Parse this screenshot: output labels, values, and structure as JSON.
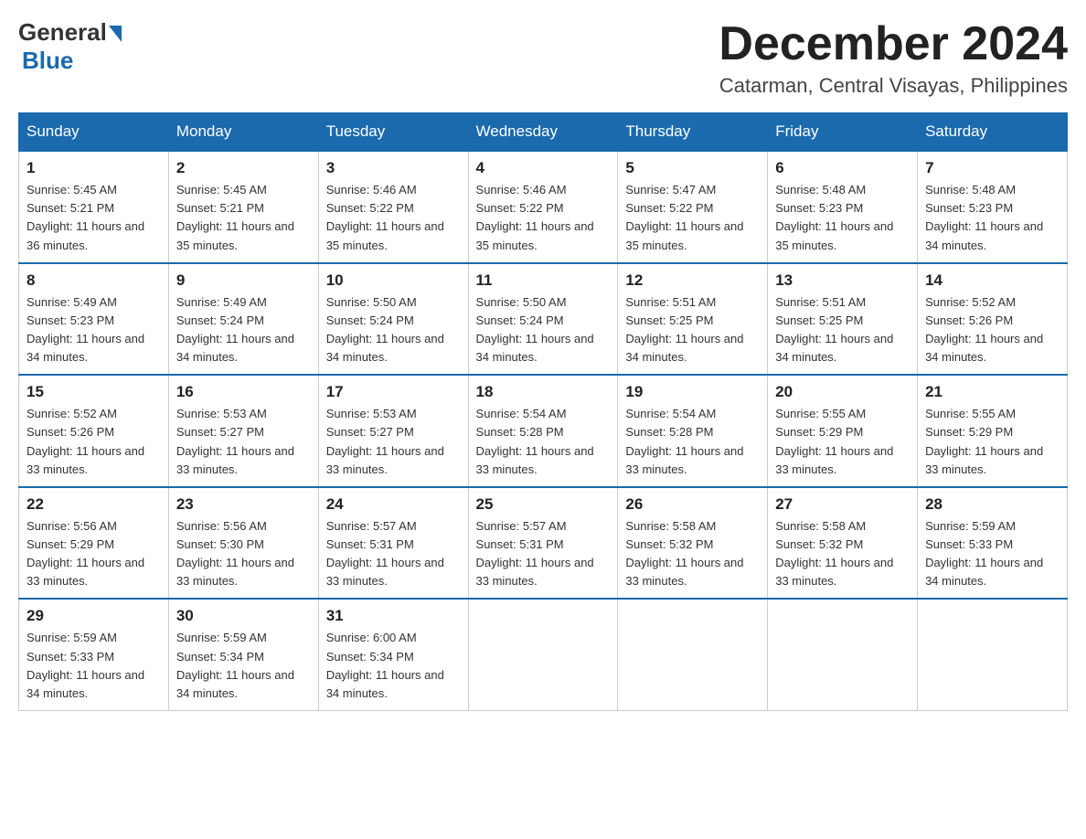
{
  "logo": {
    "general": "General",
    "blue": "Blue"
  },
  "header": {
    "month_year": "December 2024",
    "location": "Catarman, Central Visayas, Philippines"
  },
  "days_of_week": [
    "Sunday",
    "Monday",
    "Tuesday",
    "Wednesday",
    "Thursday",
    "Friday",
    "Saturday"
  ],
  "weeks": [
    [
      {
        "day": "1",
        "sunrise": "5:45 AM",
        "sunset": "5:21 PM",
        "daylight": "11 hours and 36 minutes."
      },
      {
        "day": "2",
        "sunrise": "5:45 AM",
        "sunset": "5:21 PM",
        "daylight": "11 hours and 35 minutes."
      },
      {
        "day": "3",
        "sunrise": "5:46 AM",
        "sunset": "5:22 PM",
        "daylight": "11 hours and 35 minutes."
      },
      {
        "day": "4",
        "sunrise": "5:46 AM",
        "sunset": "5:22 PM",
        "daylight": "11 hours and 35 minutes."
      },
      {
        "day": "5",
        "sunrise": "5:47 AM",
        "sunset": "5:22 PM",
        "daylight": "11 hours and 35 minutes."
      },
      {
        "day": "6",
        "sunrise": "5:48 AM",
        "sunset": "5:23 PM",
        "daylight": "11 hours and 35 minutes."
      },
      {
        "day": "7",
        "sunrise": "5:48 AM",
        "sunset": "5:23 PM",
        "daylight": "11 hours and 34 minutes."
      }
    ],
    [
      {
        "day": "8",
        "sunrise": "5:49 AM",
        "sunset": "5:23 PM",
        "daylight": "11 hours and 34 minutes."
      },
      {
        "day": "9",
        "sunrise": "5:49 AM",
        "sunset": "5:24 PM",
        "daylight": "11 hours and 34 minutes."
      },
      {
        "day": "10",
        "sunrise": "5:50 AM",
        "sunset": "5:24 PM",
        "daylight": "11 hours and 34 minutes."
      },
      {
        "day": "11",
        "sunrise": "5:50 AM",
        "sunset": "5:24 PM",
        "daylight": "11 hours and 34 minutes."
      },
      {
        "day": "12",
        "sunrise": "5:51 AM",
        "sunset": "5:25 PM",
        "daylight": "11 hours and 34 minutes."
      },
      {
        "day": "13",
        "sunrise": "5:51 AM",
        "sunset": "5:25 PM",
        "daylight": "11 hours and 34 minutes."
      },
      {
        "day": "14",
        "sunrise": "5:52 AM",
        "sunset": "5:26 PM",
        "daylight": "11 hours and 34 minutes."
      }
    ],
    [
      {
        "day": "15",
        "sunrise": "5:52 AM",
        "sunset": "5:26 PM",
        "daylight": "11 hours and 33 minutes."
      },
      {
        "day": "16",
        "sunrise": "5:53 AM",
        "sunset": "5:27 PM",
        "daylight": "11 hours and 33 minutes."
      },
      {
        "day": "17",
        "sunrise": "5:53 AM",
        "sunset": "5:27 PM",
        "daylight": "11 hours and 33 minutes."
      },
      {
        "day": "18",
        "sunrise": "5:54 AM",
        "sunset": "5:28 PM",
        "daylight": "11 hours and 33 minutes."
      },
      {
        "day": "19",
        "sunrise": "5:54 AM",
        "sunset": "5:28 PM",
        "daylight": "11 hours and 33 minutes."
      },
      {
        "day": "20",
        "sunrise": "5:55 AM",
        "sunset": "5:29 PM",
        "daylight": "11 hours and 33 minutes."
      },
      {
        "day": "21",
        "sunrise": "5:55 AM",
        "sunset": "5:29 PM",
        "daylight": "11 hours and 33 minutes."
      }
    ],
    [
      {
        "day": "22",
        "sunrise": "5:56 AM",
        "sunset": "5:29 PM",
        "daylight": "11 hours and 33 minutes."
      },
      {
        "day": "23",
        "sunrise": "5:56 AM",
        "sunset": "5:30 PM",
        "daylight": "11 hours and 33 minutes."
      },
      {
        "day": "24",
        "sunrise": "5:57 AM",
        "sunset": "5:31 PM",
        "daylight": "11 hours and 33 minutes."
      },
      {
        "day": "25",
        "sunrise": "5:57 AM",
        "sunset": "5:31 PM",
        "daylight": "11 hours and 33 minutes."
      },
      {
        "day": "26",
        "sunrise": "5:58 AM",
        "sunset": "5:32 PM",
        "daylight": "11 hours and 33 minutes."
      },
      {
        "day": "27",
        "sunrise": "5:58 AM",
        "sunset": "5:32 PM",
        "daylight": "11 hours and 33 minutes."
      },
      {
        "day": "28",
        "sunrise": "5:59 AM",
        "sunset": "5:33 PM",
        "daylight": "11 hours and 34 minutes."
      }
    ],
    [
      {
        "day": "29",
        "sunrise": "5:59 AM",
        "sunset": "5:33 PM",
        "daylight": "11 hours and 34 minutes."
      },
      {
        "day": "30",
        "sunrise": "5:59 AM",
        "sunset": "5:34 PM",
        "daylight": "11 hours and 34 minutes."
      },
      {
        "day": "31",
        "sunrise": "6:00 AM",
        "sunset": "5:34 PM",
        "daylight": "11 hours and 34 minutes."
      },
      null,
      null,
      null,
      null
    ]
  ]
}
